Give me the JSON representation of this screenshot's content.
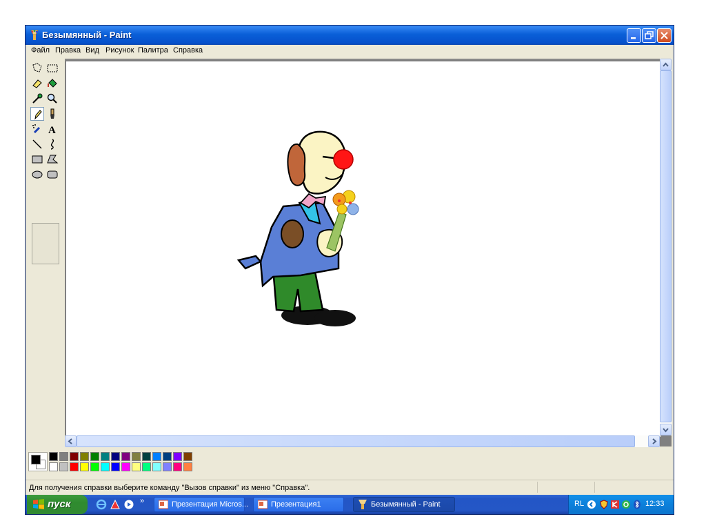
{
  "window": {
    "title": "Безымянный - Paint",
    "buttons": {
      "minimize": "minimize-icon",
      "restore": "restore-icon",
      "close": "close-icon"
    }
  },
  "menu": [
    "Файл",
    "Правка",
    "Вид",
    "Рисунок",
    "Палитра",
    "Справка"
  ],
  "tools": [
    {
      "name": "free-form-select-icon"
    },
    {
      "name": "rect-select-icon"
    },
    {
      "name": "eraser-icon"
    },
    {
      "name": "fill-bucket-icon"
    },
    {
      "name": "color-picker-icon"
    },
    {
      "name": "magnifier-icon"
    },
    {
      "name": "pencil-icon",
      "selected": true
    },
    {
      "name": "brush-icon"
    },
    {
      "name": "airbrush-icon"
    },
    {
      "name": "text-icon",
      "glyph": "A"
    },
    {
      "name": "line-icon"
    },
    {
      "name": "curve-icon"
    },
    {
      "name": "rectangle-icon"
    },
    {
      "name": "polygon-icon"
    },
    {
      "name": "ellipse-icon"
    },
    {
      "name": "rounded-rect-icon"
    }
  ],
  "palette": {
    "foreground": "#000000",
    "background": "#ffffff",
    "row1": [
      "#000000",
      "#808080",
      "#800000",
      "#808000",
      "#008000",
      "#008080",
      "#000080",
      "#800080",
      "#808040",
      "#004040",
      "#0080ff",
      "#004080",
      "#8000ff",
      "#804000"
    ],
    "row2": [
      "#ffffff",
      "#c0c0c0",
      "#ff0000",
      "#ffff00",
      "#00ff00",
      "#00ffff",
      "#0000ff",
      "#ff00ff",
      "#ffff80",
      "#00ff80",
      "#80ffff",
      "#8080ff",
      "#ff0080",
      "#ff8040"
    ]
  },
  "status": {
    "text": "Для получения справки выберите команду \"Вызов справки\" из меню \"Справка\"."
  },
  "taskbar": {
    "start": "пуск",
    "tasks": [
      {
        "label": "Презентация Micros...",
        "icon": "powerpoint-icon"
      },
      {
        "label": "Презентация1",
        "icon": "powerpoint-icon"
      },
      {
        "label": "Безымянный - Paint",
        "icon": "paint-icon",
        "active": true
      }
    ],
    "tray": {
      "lang": "RL",
      "clock": "12:33"
    }
  },
  "canvas": {
    "image": "clown-with-flowers-clipart"
  }
}
